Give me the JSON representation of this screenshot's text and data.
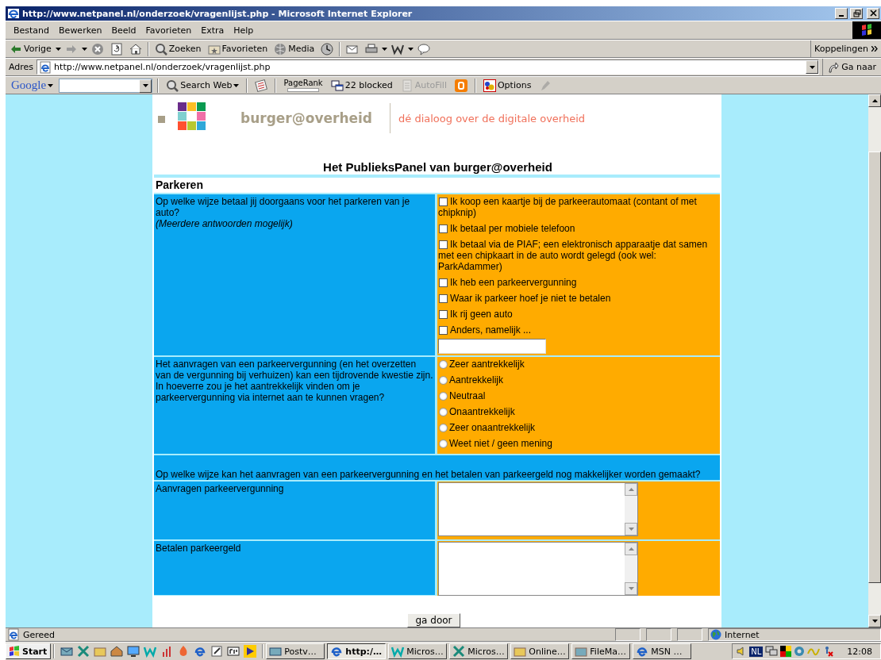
{
  "window": {
    "title": "http://www.netpanel.nl/onderzoek/vragenlijst.php - Microsoft Internet Explorer"
  },
  "menu": [
    "Bestand",
    "Bewerken",
    "Beeld",
    "Favorieten",
    "Extra",
    "Help"
  ],
  "toolbar": {
    "items": [
      {
        "kind": "back",
        "label": "Vorige"
      },
      {
        "kind": "forward"
      },
      {
        "kind": "stop"
      },
      {
        "kind": "refresh"
      },
      {
        "kind": "home"
      },
      {
        "kind": "search",
        "label": "Zoeken"
      },
      {
        "kind": "favorites",
        "label": "Favorieten"
      },
      {
        "kind": "media",
        "label": "Media"
      },
      {
        "kind": "history"
      },
      {
        "kind": "mail"
      },
      {
        "kind": "print"
      },
      {
        "kind": "word"
      },
      {
        "kind": "discuss"
      }
    ],
    "links": "Koppelingen"
  },
  "address": {
    "label": "Adres",
    "value": "http://www.netpanel.nl/onderzoek/vragenlijst.php",
    "go": "Ga naar"
  },
  "google": {
    "logo": "Google",
    "items": [
      {
        "kind": "search",
        "label": "Search Web",
        "disabled": false
      },
      {
        "kind": "news",
        "disabled": false
      },
      {
        "kind": "pagerank",
        "label": "PageRank",
        "disabled": false
      },
      {
        "kind": "popup",
        "label": "22 blocked",
        "disabled": false
      },
      {
        "kind": "autofill",
        "label": "AutoFill",
        "disabled": true
      },
      {
        "kind": "blogger",
        "disabled": false
      },
      {
        "kind": "options",
        "label": "Options",
        "disabled": false
      },
      {
        "kind": "highlight",
        "disabled": true
      }
    ]
  },
  "page": {
    "brand": "burger@overheid",
    "tagline": "dé dialoog over de digitale overheid",
    "heading": "Het PublieksPanel van burger@overheid",
    "section": "Parkeren",
    "questions": [
      {
        "kind": "checkbox",
        "question": "Op welke wijze betaal jij doorgaans voor het parkeren van je auto?",
        "note": "(Meerdere antwoorden mogelijk)",
        "text_field": true,
        "options": [
          {
            "label": "Ik koop een kaartje bij de parkeerautomaat (contant of met chipknip)",
            "checked": false
          },
          {
            "label": "Ik betaal per mobiele telefoon",
            "checked": false
          },
          {
            "label": "Ik betaal via de PIAF; een elektronisch apparaatje dat samen met een chipkaart in de auto wordt gelegd (ook wel: ParkAdammer)",
            "checked": false
          },
          {
            "label": "Ik heb een parkeervergunning",
            "checked": false
          },
          {
            "label": "Waar ik parkeer hoef je niet te betalen",
            "checked": false
          },
          {
            "label": "Ik rij geen auto",
            "checked": false
          },
          {
            "label": "Anders, namelijk ...",
            "checked": false
          }
        ]
      },
      {
        "kind": "radio",
        "question": "Het aanvragen van een parkeervergunning (en het overzetten van de vergunning bij verhuizen) kan een tijdrovende kwestie zijn. In hoeverre zou je het aantrekkelijk vinden om je parkeervergunning via internet aan te kunnen vragen?",
        "options": [
          {
            "label": "Zeer aantrekkelijk",
            "selected": false
          },
          {
            "label": "Aantrekkelijk",
            "selected": false
          },
          {
            "label": "Neutraal",
            "selected": false
          },
          {
            "label": "Onaantrekkelijk",
            "selected": false
          },
          {
            "label": "Zeer onaantrekkelijk",
            "selected": false
          },
          {
            "label": "Weet niet / geen mening",
            "selected": false
          }
        ]
      }
    ],
    "subheading": "Op welke wijze kan het aanvragen van een parkeervergunning en het betalen van parkeergeld nog makkelijker worden gemaakt?",
    "text_questions": [
      {
        "label": "Aanvragen parkeervergunning"
      },
      {
        "label": "Betalen parkeergeld"
      }
    ],
    "submit": "ga door"
  },
  "status_bar": {
    "text": "Gereed",
    "zone": "Internet"
  },
  "taskbar": {
    "start": "Start",
    "tasks": [
      {
        "label": "Postv…",
        "selected": false
      },
      {
        "label": "http:/…",
        "selected": true
      },
      {
        "label": "Micros…",
        "selected": false
      },
      {
        "label": "Micros…",
        "selected": false
      },
      {
        "label": "Online…",
        "selected": false
      },
      {
        "label": "FileMa…",
        "selected": false
      },
      {
        "label": "MSN …",
        "selected": false
      }
    ],
    "language": "NL",
    "time": "12:08"
  }
}
